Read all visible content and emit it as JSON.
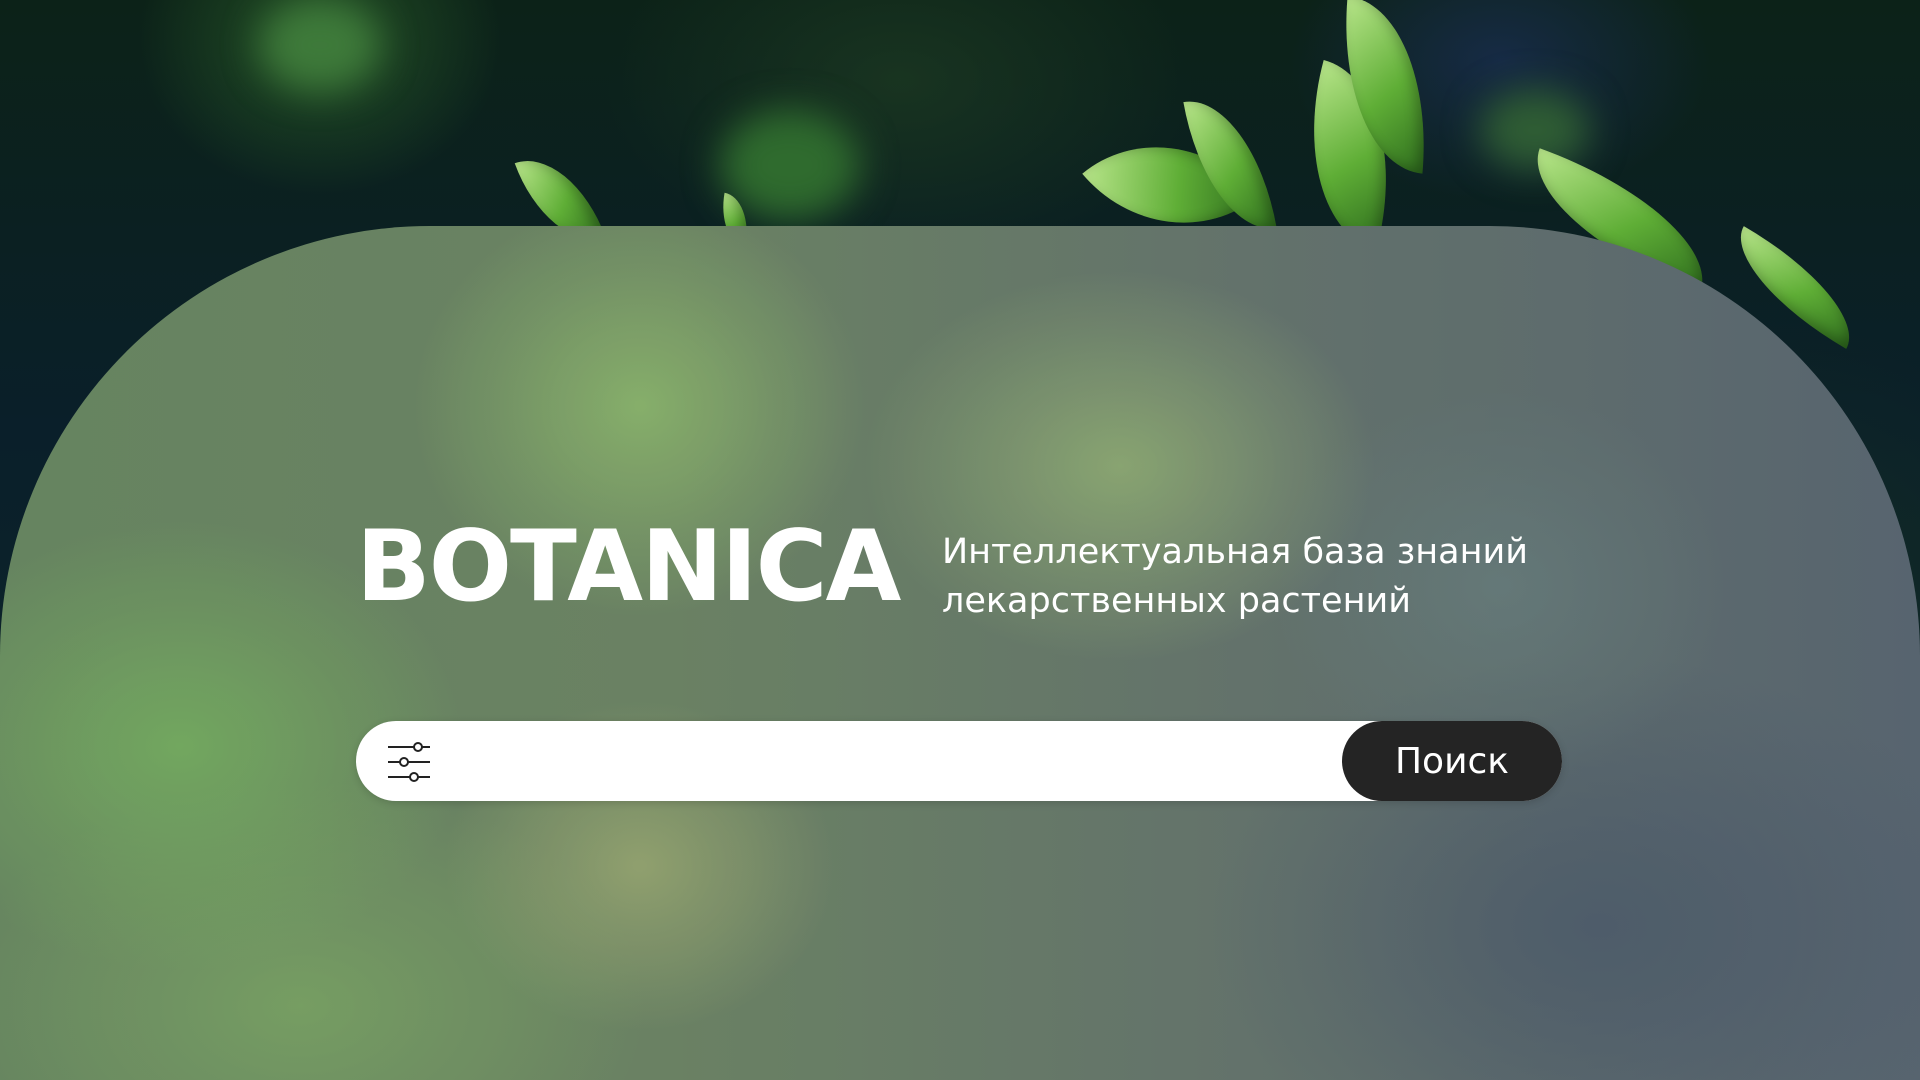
{
  "brand": {
    "title": "BOTANICA",
    "subtitle_line1": "Интеллектуальная база знаний",
    "subtitle_line2": "лекарственных растений"
  },
  "search": {
    "value": "",
    "placeholder": "",
    "button_label": "Поиск",
    "filter_icon": "sliders-icon"
  },
  "colors": {
    "button_bg": "#242424",
    "input_bg": "#ffffff",
    "text": "#ffffff"
  }
}
